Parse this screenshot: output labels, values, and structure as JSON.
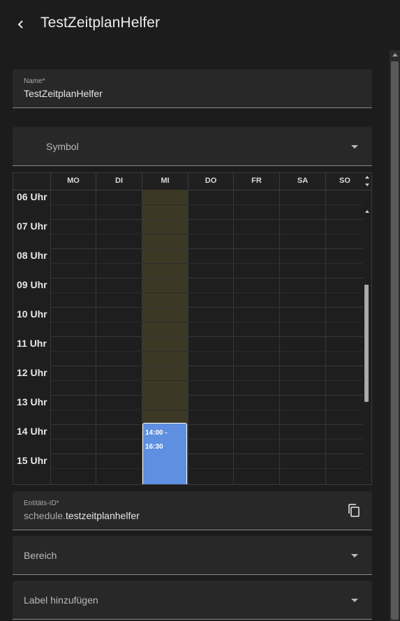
{
  "header": {
    "title": "TestZeitplanHelfer",
    "back_icon": "chevron-left-icon"
  },
  "name_field": {
    "label": "Name*",
    "value": "TestZeitplanHelfer"
  },
  "symbol_field": {
    "label": "Symbol"
  },
  "schedule": {
    "days": [
      "MO",
      "DI",
      "MI",
      "DO",
      "FR",
      "SA",
      "SO"
    ],
    "hours": [
      "06 Uhr",
      "07 Uhr",
      "08 Uhr",
      "09 Uhr",
      "10 Uhr",
      "11 Uhr",
      "12 Uhr",
      "13 Uhr",
      "14 Uhr",
      "15 Uhr"
    ],
    "event": {
      "day": "MI",
      "start": "14:00 -",
      "end": "16:30"
    },
    "today_color": "#3b3926",
    "event_color": "#5e8fe0"
  },
  "entity_field": {
    "label": "Entitäts-ID*",
    "prefix": "schedule.",
    "value": "testzeitplanhelfer",
    "copy_icon": "copy-icon"
  },
  "area_field": {
    "label": "Bereich"
  },
  "labels_field": {
    "label": "Label hinzufügen"
  }
}
